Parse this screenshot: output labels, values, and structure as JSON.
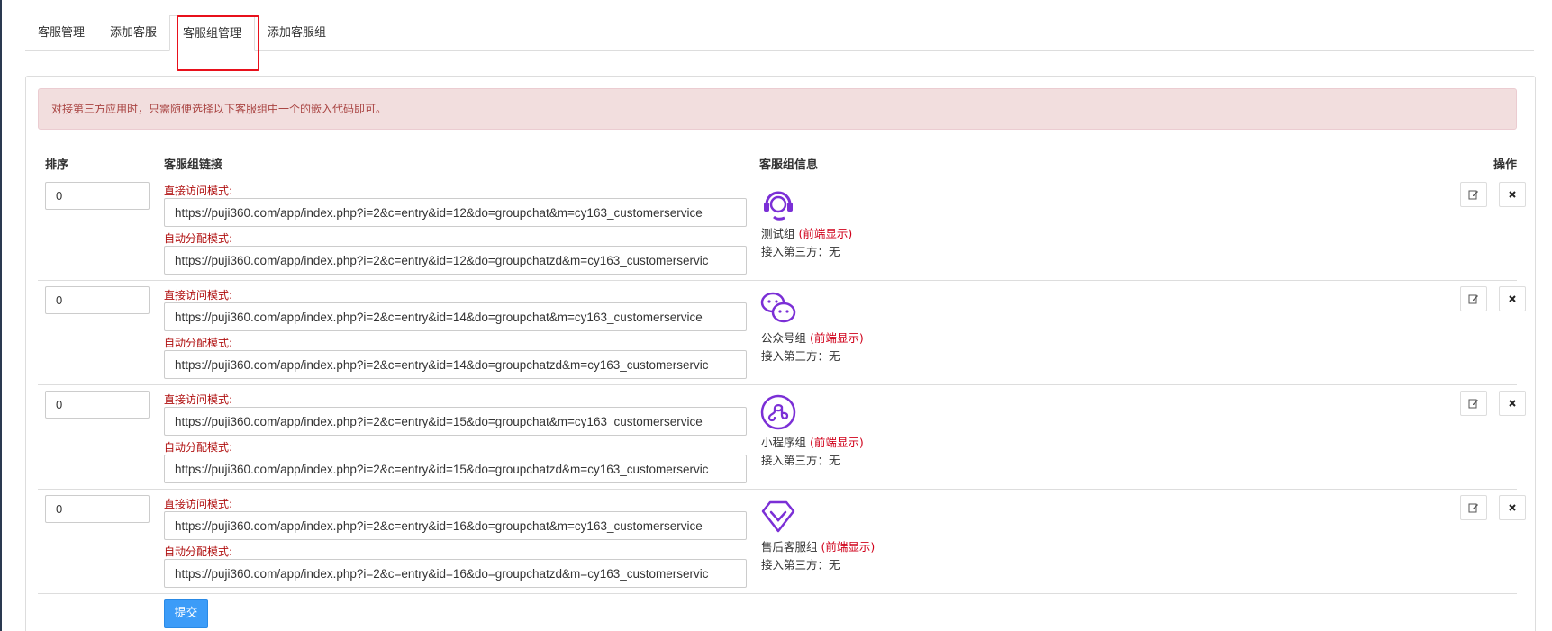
{
  "tabs": [
    {
      "label": "客服管理"
    },
    {
      "label": "添加客服"
    },
    {
      "label": "客服组管理"
    },
    {
      "label": "添加客服组"
    }
  ],
  "alert": "对接第三方应用时，只需随便选择以下客服组中一个的嵌入代码即可。",
  "table": {
    "headers": {
      "sort": "排序",
      "link": "客服组链接",
      "info": "客服组信息",
      "ops": "操作"
    },
    "rows": [
      {
        "sort": "0",
        "direct_label": "直接访问模式:",
        "direct_url": "https://puji360.com/app/index.php?i=2&c=entry&id=12&do=groupchat&m=cy163_customerservice",
        "auto_label": "自动分配模式:",
        "auto_url": "https://puji360.com/app/index.php?i=2&c=entry&id=12&do=groupchatzd&m=cy163_customerservic",
        "name": "测试组",
        "front": "(前端显示)",
        "third": "接入第三方：无",
        "icon": "headset-icon"
      },
      {
        "sort": "0",
        "direct_label": "直接访问模式:",
        "direct_url": "https://puji360.com/app/index.php?i=2&c=entry&id=14&do=groupchat&m=cy163_customerservice",
        "auto_label": "自动分配模式:",
        "auto_url": "https://puji360.com/app/index.php?i=2&c=entry&id=14&do=groupchatzd&m=cy163_customerservic",
        "name": "公众号组",
        "front": "(前端显示)",
        "third": "接入第三方：无",
        "icon": "wechat-icon"
      },
      {
        "sort": "0",
        "direct_label": "直接访问模式:",
        "direct_url": "https://puji360.com/app/index.php?i=2&c=entry&id=15&do=groupchat&m=cy163_customerservice",
        "auto_label": "自动分配模式:",
        "auto_url": "https://puji360.com/app/index.php?i=2&c=entry&id=15&do=groupchatzd&m=cy163_customerservic",
        "name": "小程序组",
        "front": "(前端显示)",
        "third": "接入第三方：无",
        "icon": "mini-program-icon"
      },
      {
        "sort": "0",
        "direct_label": "直接访问模式:",
        "direct_url": "https://puji360.com/app/index.php?i=2&c=entry&id=16&do=groupchat&m=cy163_customerservice",
        "auto_label": "自动分配模式:",
        "auto_url": "https://puji360.com/app/index.php?i=2&c=entry&id=16&do=groupchatzd&m=cy163_customerservic",
        "name": "售后客服组",
        "front": "(前端显示)",
        "third": "接入第三方：无",
        "icon": "diamond-icon"
      }
    ]
  },
  "ops": {
    "edit_icon": "edit-icon",
    "delete_icon": "close-icon"
  },
  "submit_label": "提交",
  "colors": {
    "alert_bg": "#f2dede",
    "alert_text": "#a94442",
    "label_red": "#b01010",
    "front_red": "#d0021b",
    "icon_purple": "#7b2fd6",
    "submit_blue": "#3c9cf8",
    "highlight_red": "#e8101b"
  }
}
